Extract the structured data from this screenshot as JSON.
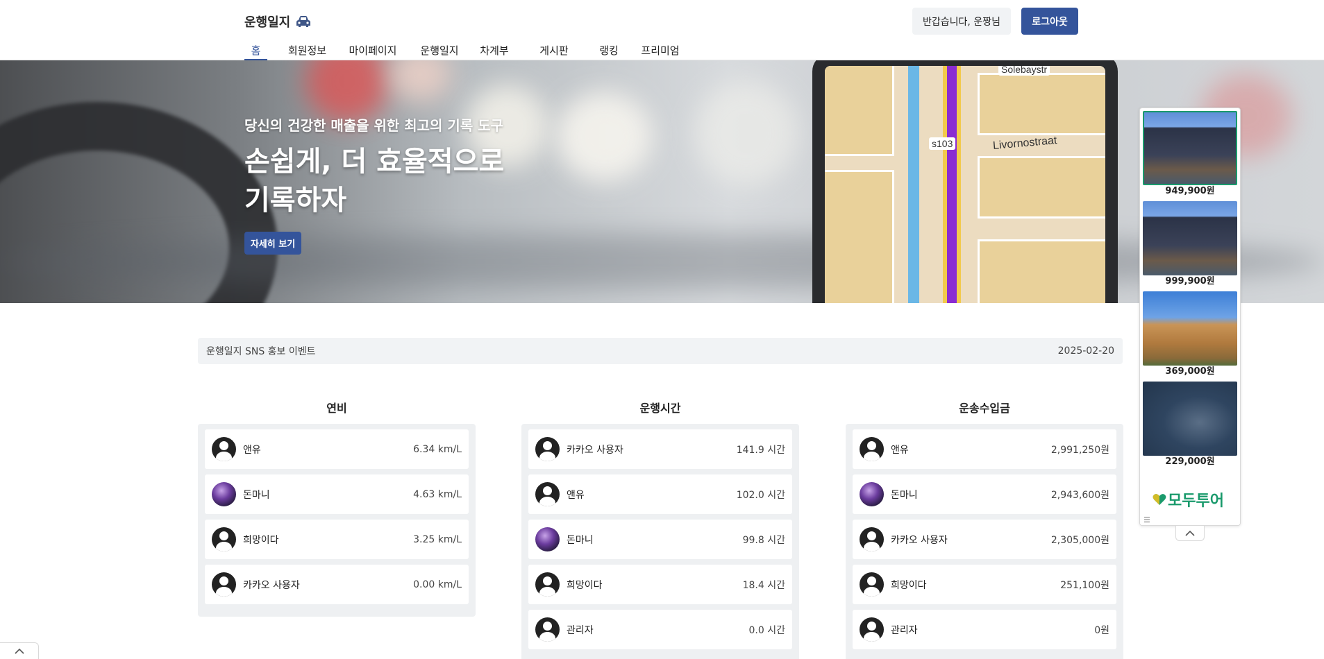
{
  "header": {
    "brand": "운행일지",
    "welcome": "반갑습니다, 운짱님",
    "logout": "로그아웃",
    "nav": [
      "홈",
      "회원정보",
      "마이페이지",
      "운행일지",
      "차계부",
      "게시판",
      "랭킹",
      "프리미엄"
    ],
    "active_nav": "홈"
  },
  "hero": {
    "subtitle": "당신의 건강한 매출을 위한 최고의 기록 도구",
    "title_line1": "손쉽게, 더 효율적으로",
    "title_line2": "기록하자",
    "button": "자세히 보기",
    "map_labels": [
      "Solebaystr",
      "s103",
      "Livornostraat"
    ]
  },
  "notice": {
    "title": "운행일지 SNS 홍보 이벤트",
    "date": "2025-02-20"
  },
  "rankings": [
    {
      "title": "연비",
      "rows": [
        {
          "name": "앤유",
          "value": "6.34 km/L",
          "avatar": "default"
        },
        {
          "name": "돈마니",
          "value": "4.63 km/L",
          "avatar": "photo"
        },
        {
          "name": "희망이다",
          "value": "3.25 km/L",
          "avatar": "default"
        },
        {
          "name": "카카오 사용자",
          "value": "0.00 km/L",
          "avatar": "default"
        }
      ]
    },
    {
      "title": "운행시간",
      "rows": [
        {
          "name": "카카오 사용자",
          "value": "141.9 시간",
          "avatar": "default"
        },
        {
          "name": "앤유",
          "value": "102.0 시간",
          "avatar": "default"
        },
        {
          "name": "돈마니",
          "value": "99.8 시간",
          "avatar": "photo"
        },
        {
          "name": "희망이다",
          "value": "18.4 시간",
          "avatar": "default"
        },
        {
          "name": "관리자",
          "value": "0.0 시간",
          "avatar": "default"
        }
      ]
    },
    {
      "title": "운송수입금",
      "rows": [
        {
          "name": "앤유",
          "value": "2,991,250원",
          "avatar": "default"
        },
        {
          "name": "돈마니",
          "value": "2,943,600원",
          "avatar": "photo"
        },
        {
          "name": "카카오 사용자",
          "value": "2,305,000원",
          "avatar": "default"
        },
        {
          "name": "희망이다",
          "value": "251,100원",
          "avatar": "default"
        },
        {
          "name": "관리자",
          "value": "0원",
          "avatar": "default"
        }
      ]
    }
  ],
  "ad": {
    "items": [
      {
        "price": "949,900원",
        "image": "hotel-building"
      },
      {
        "price": "999,900원",
        "image": "hotel-building"
      },
      {
        "price": "369,000원",
        "image": "rock-formation"
      },
      {
        "price": "229,000원",
        "image": "lake-pavilion"
      }
    ],
    "logo": "모두투어"
  },
  "colors": {
    "accent": "#34549b",
    "ad_brand": "#1a9a6c",
    "panel": "#eef0f2"
  }
}
